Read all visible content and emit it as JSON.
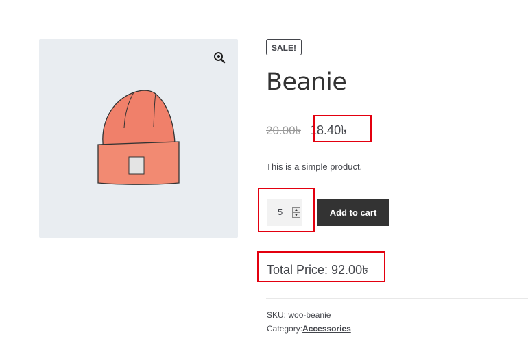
{
  "gallery": {
    "image_alt": "Beanie",
    "zoom_icon": "zoom-in-icon",
    "hat_color": "#f0806a",
    "background": "#e9edf1"
  },
  "product": {
    "badge": "SALE!",
    "title": "Beanie",
    "regular_price": "20.00৳",
    "sale_price": "18.40৳",
    "description": "This is a simple product.",
    "quantity": "5",
    "add_to_cart_label": "Add to cart",
    "total_price": "Total Price: 92.00৳",
    "sku_label": "SKU:",
    "sku_value": "woo-beanie",
    "category_label": "Category:",
    "category_value": "Accessories"
  },
  "colors": {
    "highlight": "#e3000f",
    "button": "#333333"
  }
}
